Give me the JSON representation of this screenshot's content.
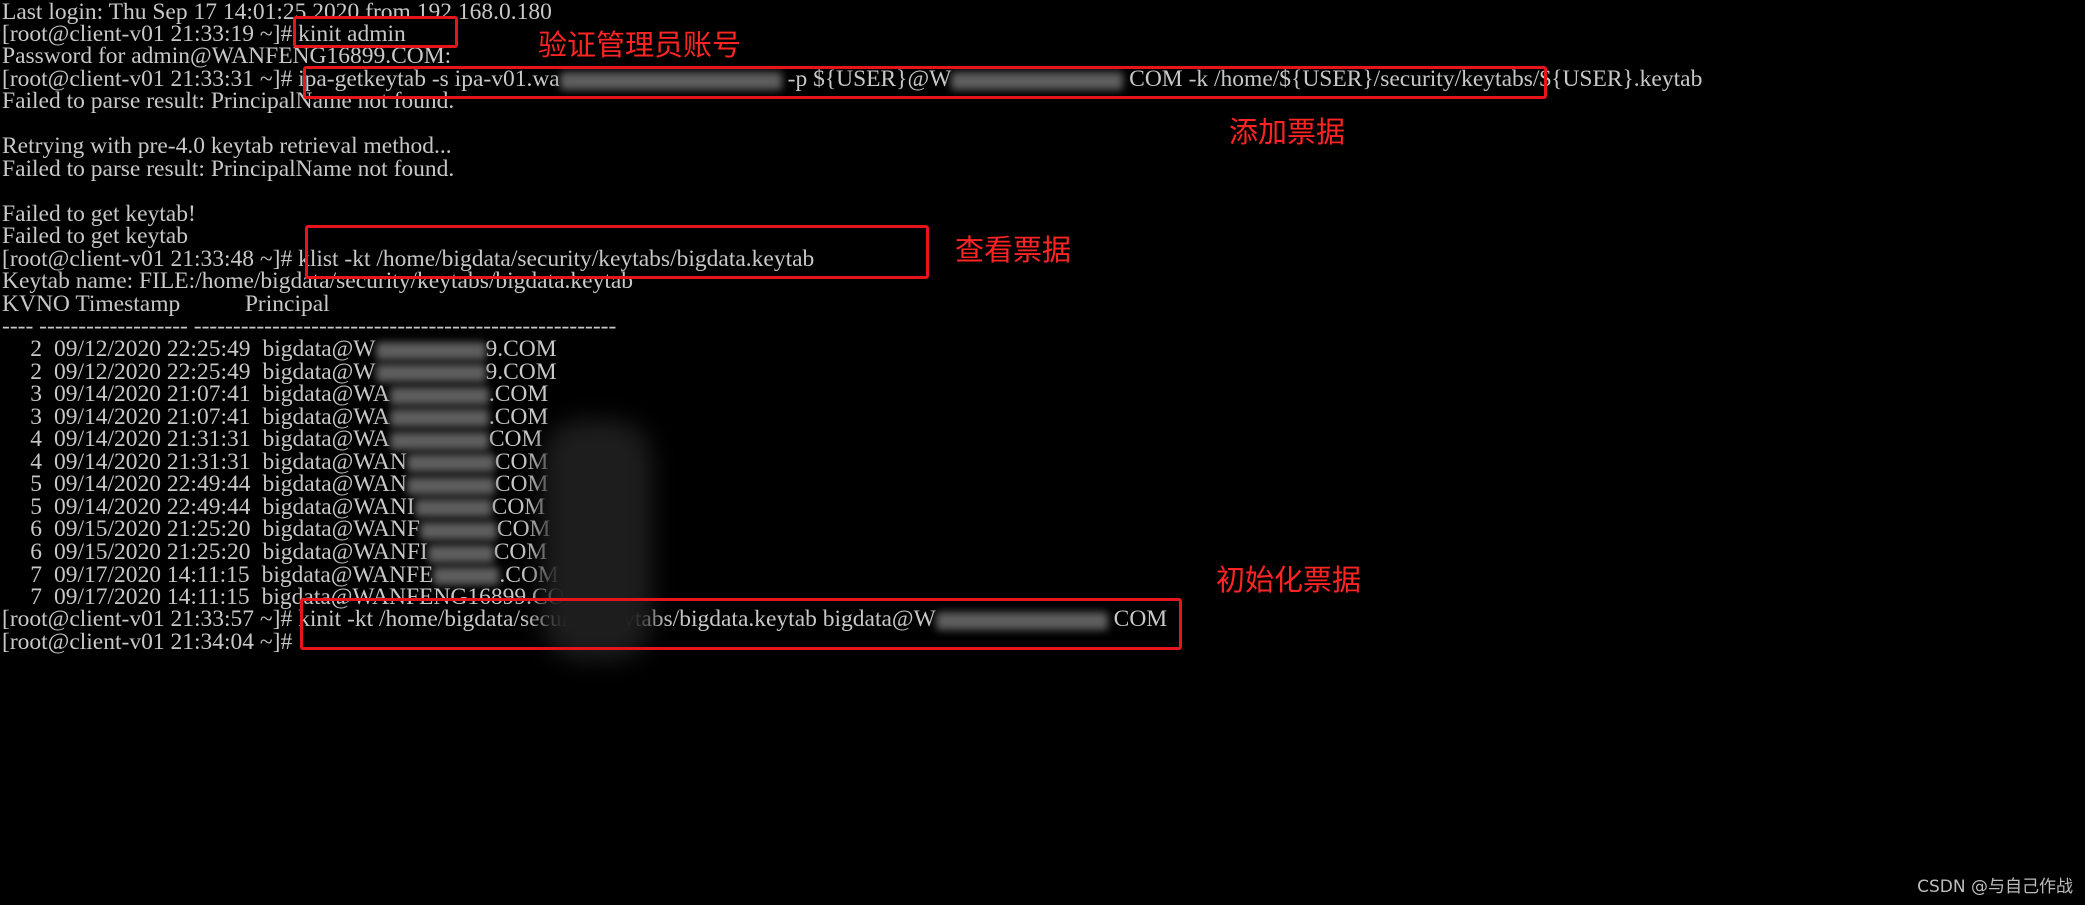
{
  "terminal": {
    "lines": [
      "Last login: Thu Sep 17 14:01:25 2020 from 192.168.0.180",
      "[root@client-v01 21:33:19 ~]# kinit admin",
      "Password for admin@WANFENG16899.COM:",
      "[root@client-v01 21:33:31 ~]# ipa-getkeytab -s ipa-v01.wa",
      "-p ${USER}@W",
      "COM -k /home/${USER}/security/keytabs/${USER}.keytab",
      "Failed to parse result: PrincipalName not found.",
      "",
      "Retrying with pre-4.0 keytab retrieval method...",
      "Failed to parse result: PrincipalName not found.",
      "",
      "Failed to get keytab!",
      "Failed to get keytab",
      "[root@client-v01 21:33:48 ~]# klist -kt /home/bigdata/security/keytabs/bigdata.keytab",
      "Keytab name: FILE:/home/bigdata/security/keytabs/bigdata.keytab",
      "KVNO Timestamp           Principal",
      "---- ------------------- ------------------------------------------------------",
      "[root@client-v01 21:33:57 ~]# kinit -kt /home/bigdata/security/keytabs/bigdata.keytab bigdata@W",
      "COM",
      "[root@client-v01 21:34:04 ~]#"
    ],
    "keytab_entries": [
      {
        "kvno": "2",
        "timestamp": "09/12/2020 22:25:49",
        "principal_visible": "bigdata@W",
        "principal_end": "9.COM"
      },
      {
        "kvno": "2",
        "timestamp": "09/12/2020 22:25:49",
        "principal_visible": "bigdata@W",
        "principal_end": "9.COM"
      },
      {
        "kvno": "3",
        "timestamp": "09/14/2020 21:07:41",
        "principal_visible": "bigdata@WA",
        "principal_end": ".COM"
      },
      {
        "kvno": "3",
        "timestamp": "09/14/2020 21:07:41",
        "principal_visible": "bigdata@WA",
        "principal_end": ".COM"
      },
      {
        "kvno": "4",
        "timestamp": "09/14/2020 21:31:31",
        "principal_visible": "bigdata@WA",
        "principal_end": "COM"
      },
      {
        "kvno": "4",
        "timestamp": "09/14/2020 21:31:31",
        "principal_visible": "bigdata@WAN",
        "principal_end": "COM"
      },
      {
        "kvno": "5",
        "timestamp": "09/14/2020 22:49:44",
        "principal_visible": "bigdata@WAN",
        "principal_end": "COM"
      },
      {
        "kvno": "5",
        "timestamp": "09/14/2020 22:49:44",
        "principal_visible": "bigdata@WANI",
        "principal_end": "COM"
      },
      {
        "kvno": "6",
        "timestamp": "09/15/2020 21:25:20",
        "principal_visible": "bigdata@WANF",
        "principal_end": "COM"
      },
      {
        "kvno": "6",
        "timestamp": "09/15/2020 21:25:20",
        "principal_visible": "bigdata@WANFI",
        "principal_end": "COM"
      },
      {
        "kvno": "7",
        "timestamp": "09/17/2020 14:11:15",
        "principal_visible": "bigdata@WANFE",
        "principal_end": ".COM"
      },
      {
        "kvno": "7",
        "timestamp": "09/17/2020 14:11:15",
        "principal_visible": "bigdata@WANFENG16899.COM",
        "principal_end": ""
      }
    ]
  },
  "annotations": {
    "verify_admin": "验证管理员账号",
    "add_ticket": "添加票据",
    "view_ticket": "查看票据",
    "init_ticket": "初始化票据"
  },
  "watermark": "CSDN @与自己作战",
  "colors": {
    "background": "#000000",
    "terminal_text": "#c8c8c8",
    "annotation_red": "#e8141b"
  }
}
